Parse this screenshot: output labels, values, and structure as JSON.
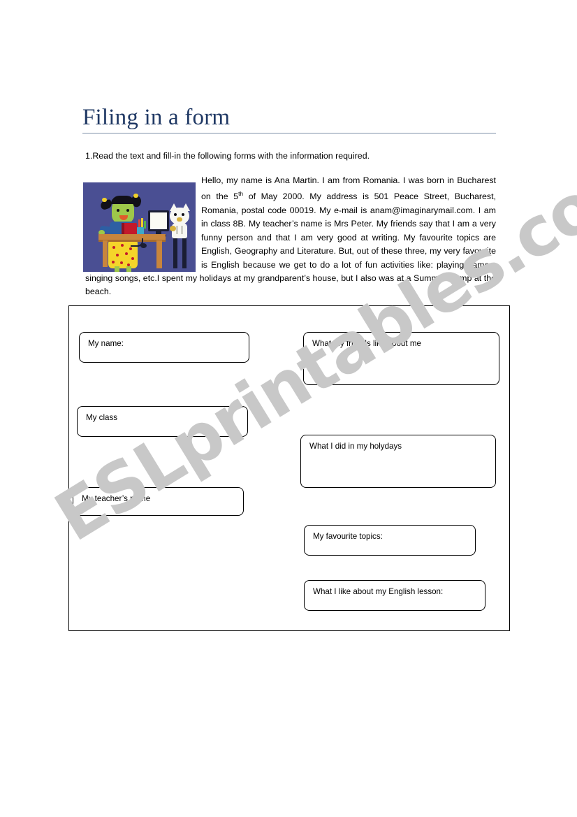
{
  "document": {
    "title": "Filing in a form",
    "instruction": "1.Read the text and fill-in the following forms with the information required.",
    "watermark": "ESLprintables.com",
    "illustration_alt": "girl-at-desk-with-computer-and-cat-illustration"
  },
  "reading_text": {
    "part1": "Hello, my name is Ana Martin. I am from Romania. I was born in Bucharest on the 5",
    "superscript": "th",
    "part2": " of May 2000. My address is 501 Peace Street, Bucharest, Romania, postal code 00019. My e-mail is anam@imaginarymail.com. I am in class 8B. My teacher’s name is Mrs Peter. My friends say that I am a very funny person and that I am very good at writing. My favourite topics are English, Geography and Literature. But, out of these three, my very favourite is English because we get to do a lot of fun activities like: playing games, singing songs, etc.I spent my holidays at my grandparent’s house, but I also was at a Summer Camp at the beach."
  },
  "form": {
    "fields": [
      {
        "id": "name",
        "label": "My name:"
      },
      {
        "id": "class",
        "label": "My class"
      },
      {
        "id": "teacher",
        "label": "My teacher’s name"
      },
      {
        "id": "friends",
        "label": "What my friends like about me"
      },
      {
        "id": "holydays",
        "label": "What I did in my holydays"
      },
      {
        "id": "topics",
        "label": "My favourite topics:"
      },
      {
        "id": "lesson",
        "label": "What I like about my English lesson:"
      }
    ]
  },
  "colors": {
    "title": "#1f3864",
    "rule": "#7d8fa8",
    "watermark": "#c8c8c8",
    "illustration_background": "#4a4f93",
    "border": "#000000"
  }
}
